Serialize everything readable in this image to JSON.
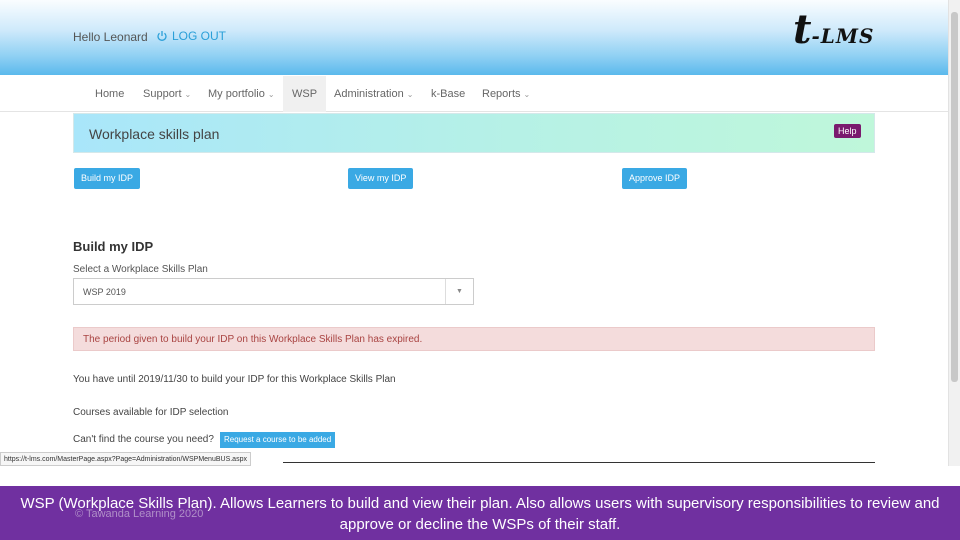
{
  "header": {
    "greeting": "Hello Leonard",
    "logout_label": "LOG OUT",
    "logo_t": "t",
    "logo_rest": "-LMS"
  },
  "nav": {
    "items": [
      {
        "label": "Home",
        "has_caret": false
      },
      {
        "label": "Support",
        "has_caret": true
      },
      {
        "label": "My portfolio",
        "has_caret": true
      },
      {
        "label": "WSP",
        "has_caret": false,
        "active": true
      },
      {
        "label": "Administration",
        "has_caret": true
      },
      {
        "label": "k-Base",
        "has_caret": false
      },
      {
        "label": "Reports",
        "has_caret": true
      }
    ],
    "caret": "⌄"
  },
  "banner": {
    "title": "Workplace skills plan",
    "help_label": "Help"
  },
  "actions": {
    "build": "Build my IDP",
    "view": "View my IDP",
    "approve": "Approve IDP"
  },
  "section": {
    "title": "Build my IDP",
    "select_label": "Select a Workplace Skills Plan",
    "select_value": "WSP 2019",
    "select_arrow": "▼"
  },
  "alert": {
    "message": "The period given to build your IDP on this Workplace Skills Plan has expired."
  },
  "info": {
    "deadline": "You have until 2019/11/30 to build your IDP for this Workplace Skills Plan",
    "courses": "Courses available for IDP selection",
    "cant_find": "Can't find the course you need?",
    "request_label": "Request a course to be added"
  },
  "status_bar": {
    "url": "https://t-lms.com/MasterPage.aspx?Page=Administration/WSPMenuBUS.aspx"
  },
  "footer": {
    "caption": "WSP (Workplace Skills Plan). Allows Learners to build and view their plan. Also allows users with supervisory responsibilities to review and approve or decline the WSPs of their staff.",
    "copyright": "© Tawanda Learning 2020"
  },
  "colors": {
    "accent": "#3aa9e4",
    "help": "#7a1a6e",
    "alert_bg": "#f4dcdc",
    "alert_text": "#a94442",
    "caption_bg": "#7030a0"
  }
}
